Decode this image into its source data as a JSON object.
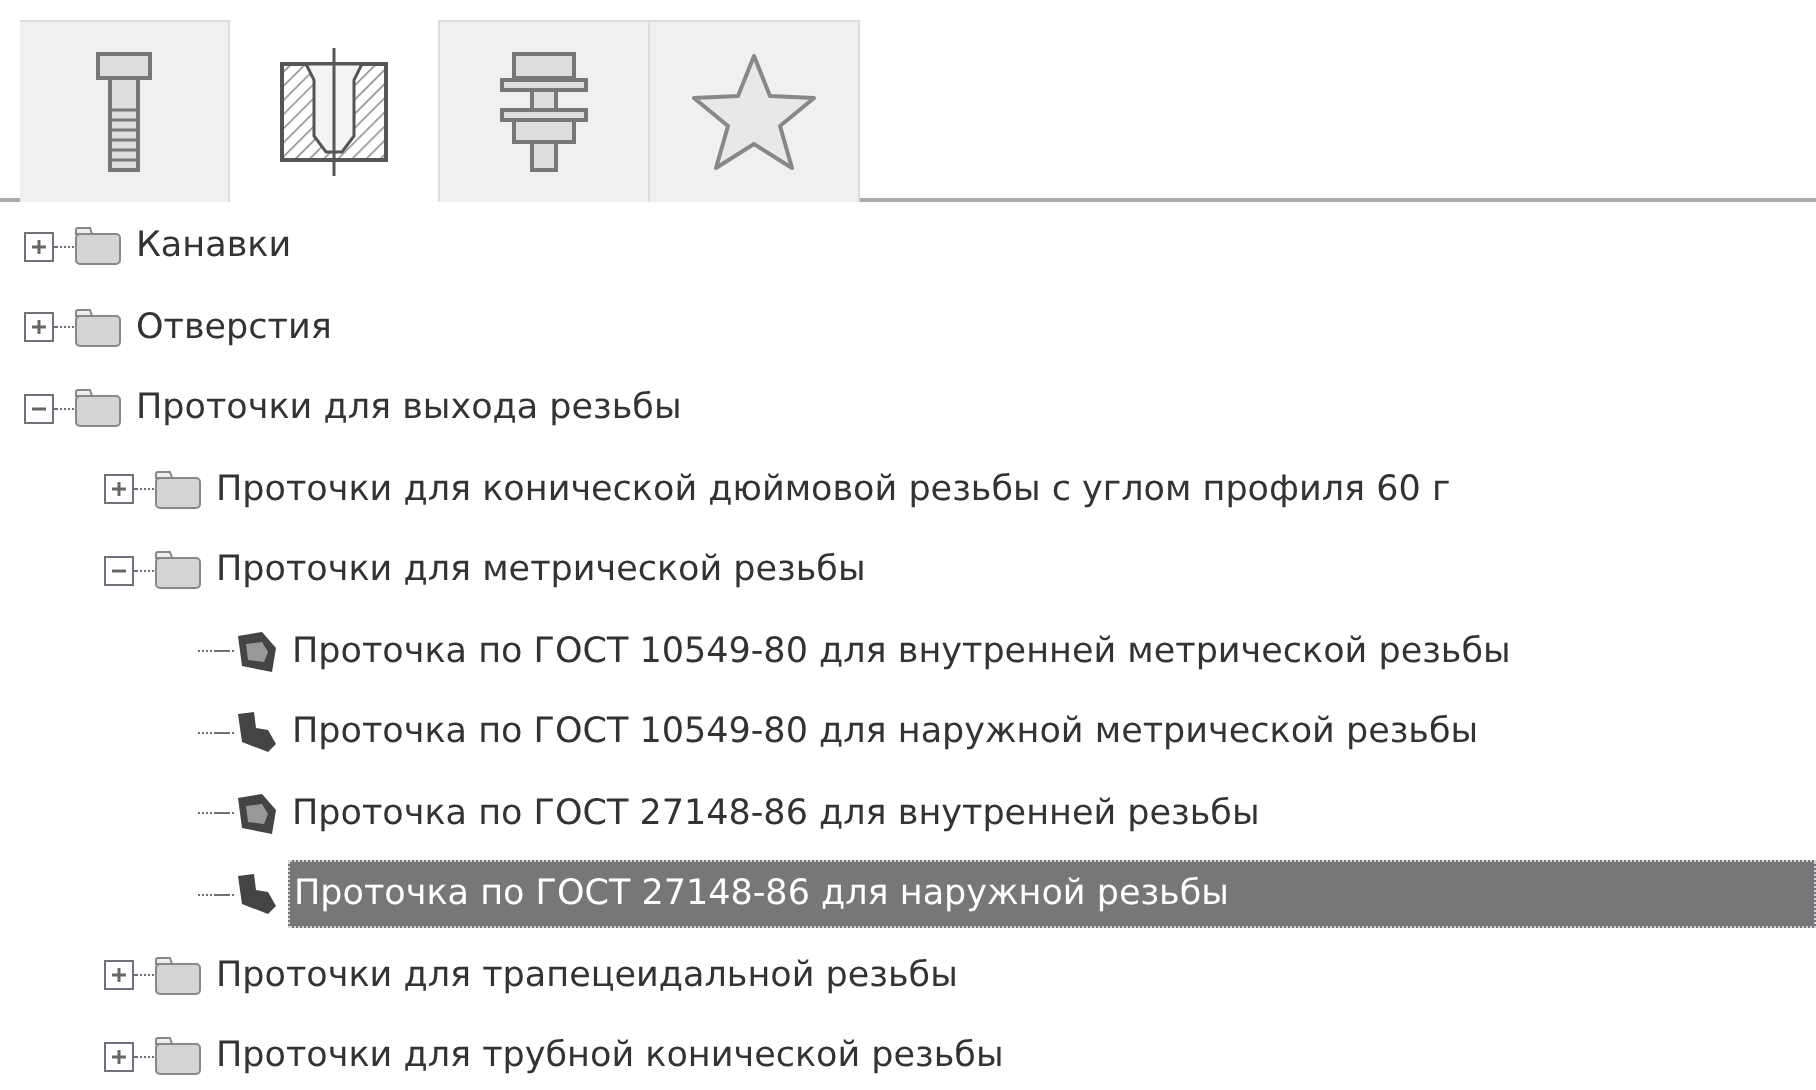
{
  "tabs": [
    {
      "kind": "bolt",
      "selected": false
    },
    {
      "kind": "hole",
      "selected": true
    },
    {
      "kind": "assembly",
      "selected": false
    },
    {
      "kind": "favorites",
      "selected": false
    }
  ],
  "tree": [
    {
      "kind": "folder",
      "label": "Канавки",
      "expanded": false,
      "selected": false
    },
    {
      "kind": "folder",
      "label": "Отверстия",
      "expanded": false,
      "selected": false
    },
    {
      "kind": "folder",
      "label": "Проточки для выхода резьбы",
      "expanded": true,
      "selected": false,
      "children": [
        {
          "kind": "folder",
          "label": "Проточки для конической дюймовой резьбы с углом профиля 60 г",
          "expanded": false,
          "selected": false
        },
        {
          "kind": "folder",
          "label": "Проточки для метрической резьбы",
          "expanded": true,
          "selected": false,
          "children": [
            {
              "kind": "internal",
              "label": "Проточка по ГОСТ 10549-80 для внутренней метрической резьбы",
              "selected": false
            },
            {
              "kind": "external",
              "label": "Проточка по ГОСТ 10549-80 для наружной метрической резьбы",
              "selected": false
            },
            {
              "kind": "internal",
              "label": "Проточка по ГОСТ 27148-86 для внутренней резьбы",
              "selected": false
            },
            {
              "kind": "external",
              "label": "Проточка по ГОСТ 27148-86 для наружной резьбы",
              "selected": true
            }
          ]
        },
        {
          "kind": "folder",
          "label": "Проточки для трапецеидальной резьбы",
          "expanded": false,
          "selected": false
        },
        {
          "kind": "folder",
          "label": "Проточки для трубной конической резьбы",
          "expanded": false,
          "selected": false
        }
      ]
    }
  ]
}
